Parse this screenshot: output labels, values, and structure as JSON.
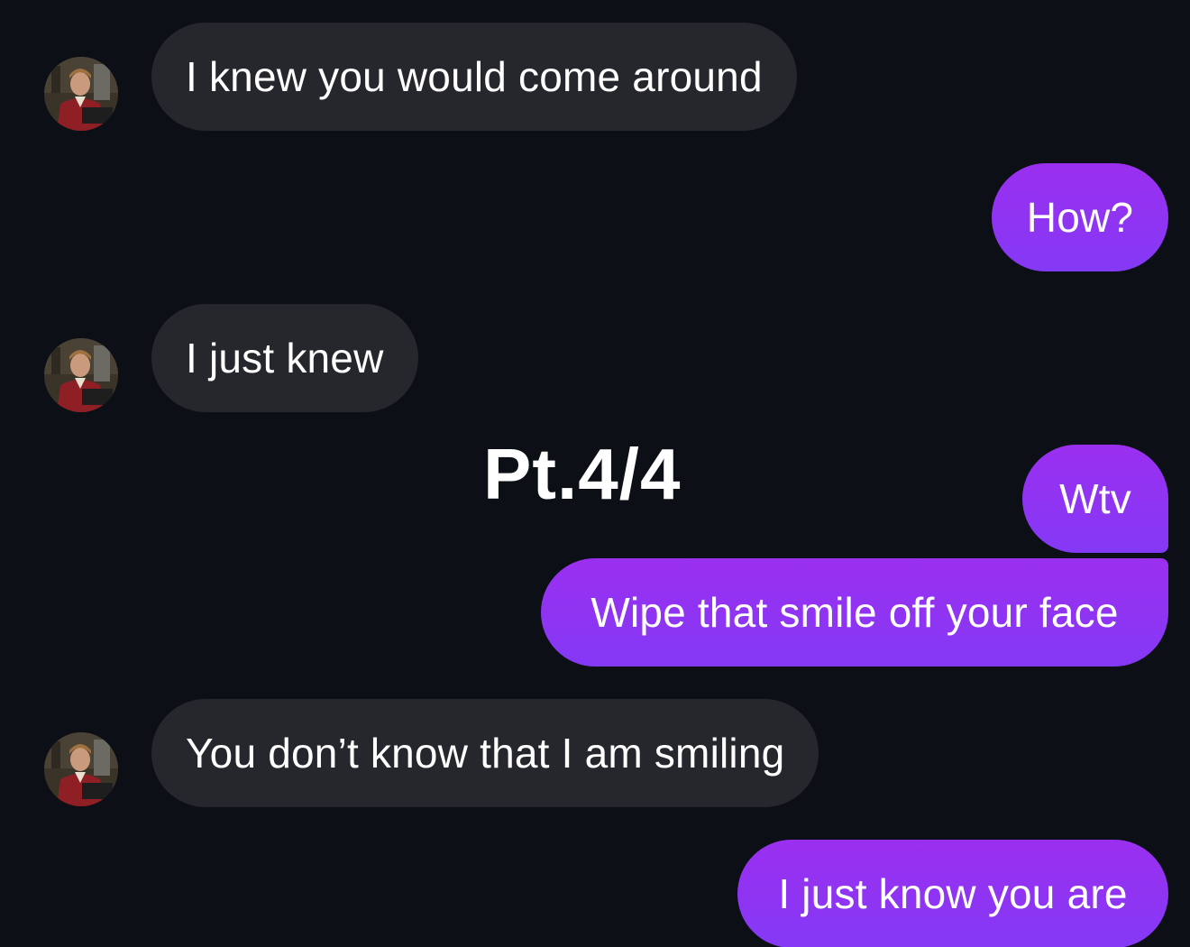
{
  "overlay": {
    "caption": "Pt.4/4"
  },
  "messages": [
    {
      "side": "incoming",
      "text": "I knew you would come around"
    },
    {
      "side": "outgoing",
      "text": "How?"
    },
    {
      "side": "incoming",
      "text": "I just knew"
    },
    {
      "side": "outgoing",
      "text": "Wtv"
    },
    {
      "side": "outgoing",
      "text": "Wipe that smile off your face"
    },
    {
      "side": "incoming",
      "text": "You don’t know that I am smiling"
    },
    {
      "side": "outgoing",
      "text": "I just know you are"
    }
  ],
  "colors": {
    "background": "#0c0f15",
    "incoming_bubble": "#25272d",
    "outgoing_bubble": "#8e35f2",
    "text": "#ffffff"
  },
  "icons": {
    "contact_avatar": "contact-photo"
  }
}
